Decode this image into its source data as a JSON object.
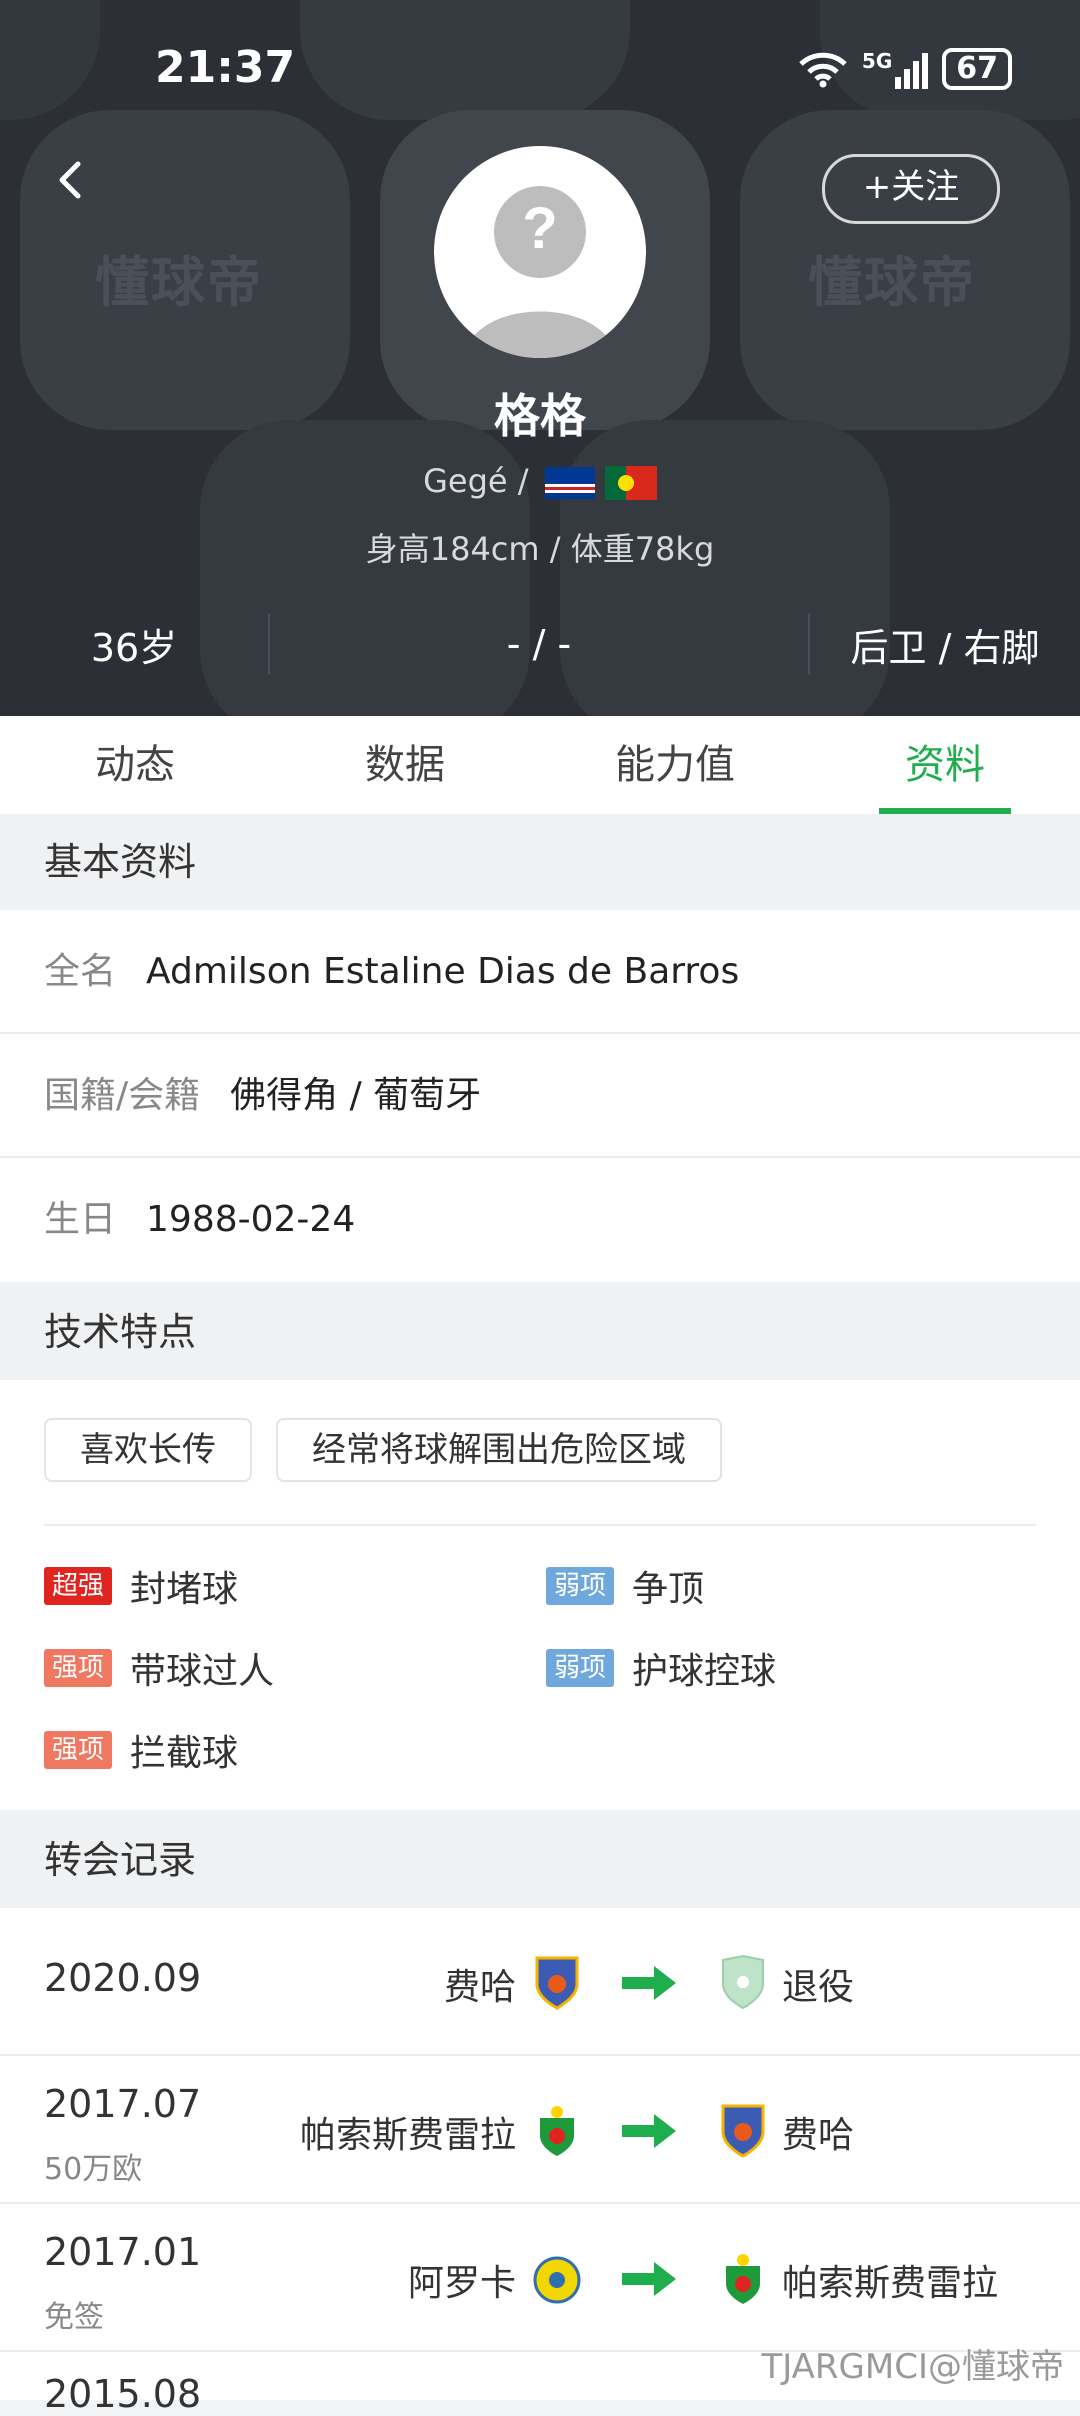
{
  "status_bar": {
    "time": "21:37",
    "signal": "5G",
    "battery": "67"
  },
  "header": {
    "watermark": "懂球帝",
    "follow_label": "+关注",
    "name": "格格",
    "sub_name": "Gegé /",
    "height_weight": "身高184cm / 体重78kg",
    "stats": {
      "age": "36岁",
      "middle": "- / -",
      "position_foot": "后卫 / 右脚"
    }
  },
  "tabs": [
    {
      "label": "动态"
    },
    {
      "label": "数据"
    },
    {
      "label": "能力值"
    },
    {
      "label": "资料"
    }
  ],
  "basic_info": {
    "title": "基本资料",
    "full_name_label": "全名",
    "full_name": "Admilson Estaline Dias de Barros",
    "nationality_label": "国籍/会籍",
    "nationality": "佛得角 / 葡萄牙",
    "birthday_label": "生日",
    "birthday": "1988-02-24"
  },
  "tech": {
    "title": "技术特点",
    "tags": [
      "喜欢长传",
      "经常将球解围出危险区域"
    ],
    "traits": [
      {
        "badge": "超强",
        "label": "封堵球",
        "color": "#e0241f"
      },
      {
        "badge": "弱项",
        "label": "争顶",
        "color": "#6fa8dc"
      },
      {
        "badge": "强项",
        "label": "带球过人",
        "color": "#f07860"
      },
      {
        "badge": "弱项",
        "label": "护球控球",
        "color": "#6fa8dc"
      },
      {
        "badge": "强项",
        "label": "拦截球",
        "color": "#f07860"
      }
    ]
  },
  "transfers": {
    "title": "转会记录",
    "items": [
      {
        "date": "2020.09",
        "fee": "",
        "from": "费哈",
        "to": "退役"
      },
      {
        "date": "2017.07",
        "fee": "50万欧",
        "from": "帕索斯费雷拉",
        "to": "费哈"
      },
      {
        "date": "2017.01",
        "fee": "免签",
        "from": "阿罗卡",
        "to": "帕索斯费雷拉"
      },
      {
        "date": "2015.08",
        "fee": "",
        "from": "",
        "to": ""
      }
    ]
  },
  "footer_watermark": "TJARGMCI@懂球帝",
  "colors": {
    "accent": "#1fae4e",
    "header_bg": "#2c3036"
  }
}
